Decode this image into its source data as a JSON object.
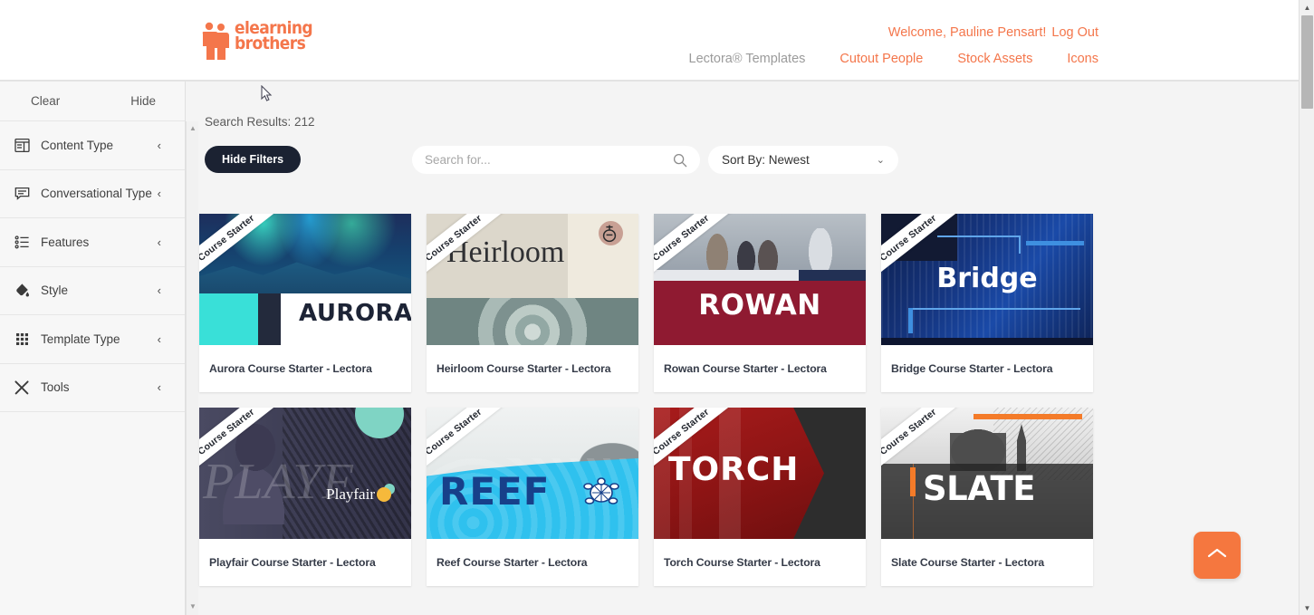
{
  "header": {
    "logo_line1": "elearning",
    "logo_line2": "brothers",
    "welcome_text": "Welcome, Pauline Pensart!",
    "logout_label": "Log Out",
    "nav": [
      {
        "label": "Lectora® Templates",
        "active": true
      },
      {
        "label": "Cutout People",
        "active": false
      },
      {
        "label": "Stock Assets",
        "active": false
      },
      {
        "label": "Icons",
        "active": false
      }
    ]
  },
  "sidebar": {
    "clear_label": "Clear",
    "hide_label": "Hide",
    "items": [
      {
        "label": "Content Type",
        "icon": "layout-icon",
        "chevron": "‹"
      },
      {
        "label": "Conversational Type",
        "icon": "chat-bubble-icon",
        "chevron": "‹"
      },
      {
        "label": "Features",
        "icon": "list-icon",
        "chevron": "‹"
      },
      {
        "label": "Style",
        "icon": "paint-bucket-icon",
        "chevron": "‹"
      },
      {
        "label": "Template Type",
        "icon": "grid-dots-icon",
        "chevron": "‹"
      },
      {
        "label": "Tools",
        "icon": "tools-icon",
        "chevron": "‹"
      }
    ]
  },
  "toolbar": {
    "results_label": "Search Results: 212",
    "hide_filters_label": "Hide Filters",
    "search_placeholder": "Search for...",
    "search_value": "",
    "sort_label": "Sort By: Newest",
    "sort_chevron": "⌄"
  },
  "ribbon_label": "Course Starter",
  "cards": [
    {
      "title": "Aurora Course Starter - Lectora",
      "word": "AURORA",
      "theme": "aurora"
    },
    {
      "title": "Heirloom Course Starter - Lectora",
      "word": "Heirloom",
      "theme": "heirloom"
    },
    {
      "title": "Rowan Course Starter - Lectora",
      "word": "ROWAN",
      "theme": "rowan"
    },
    {
      "title": "Bridge Course Starter - Lectora",
      "word": "Bridge",
      "theme": "bridge"
    },
    {
      "title": "Playfair Course Starter - Lectora",
      "word": "Playfair",
      "theme": "playfair",
      "ghost_word": "PLAYF"
    },
    {
      "title": "Reef Course Starter - Lectora",
      "word": "REEF",
      "theme": "reef"
    },
    {
      "title": "Torch Course Starter - Lectora",
      "word": "TORCH",
      "theme": "torch"
    },
    {
      "title": "Slate Course Starter - Lectora",
      "word": "SLATE",
      "theme": "slate"
    }
  ],
  "scroll_top": {
    "icon": "chevron-up-icon"
  },
  "colors": {
    "brand_orange": "#f4764b",
    "dark_pill": "#1b2232",
    "page_bg": "#f4f4f4",
    "card_title": "#353b48"
  }
}
